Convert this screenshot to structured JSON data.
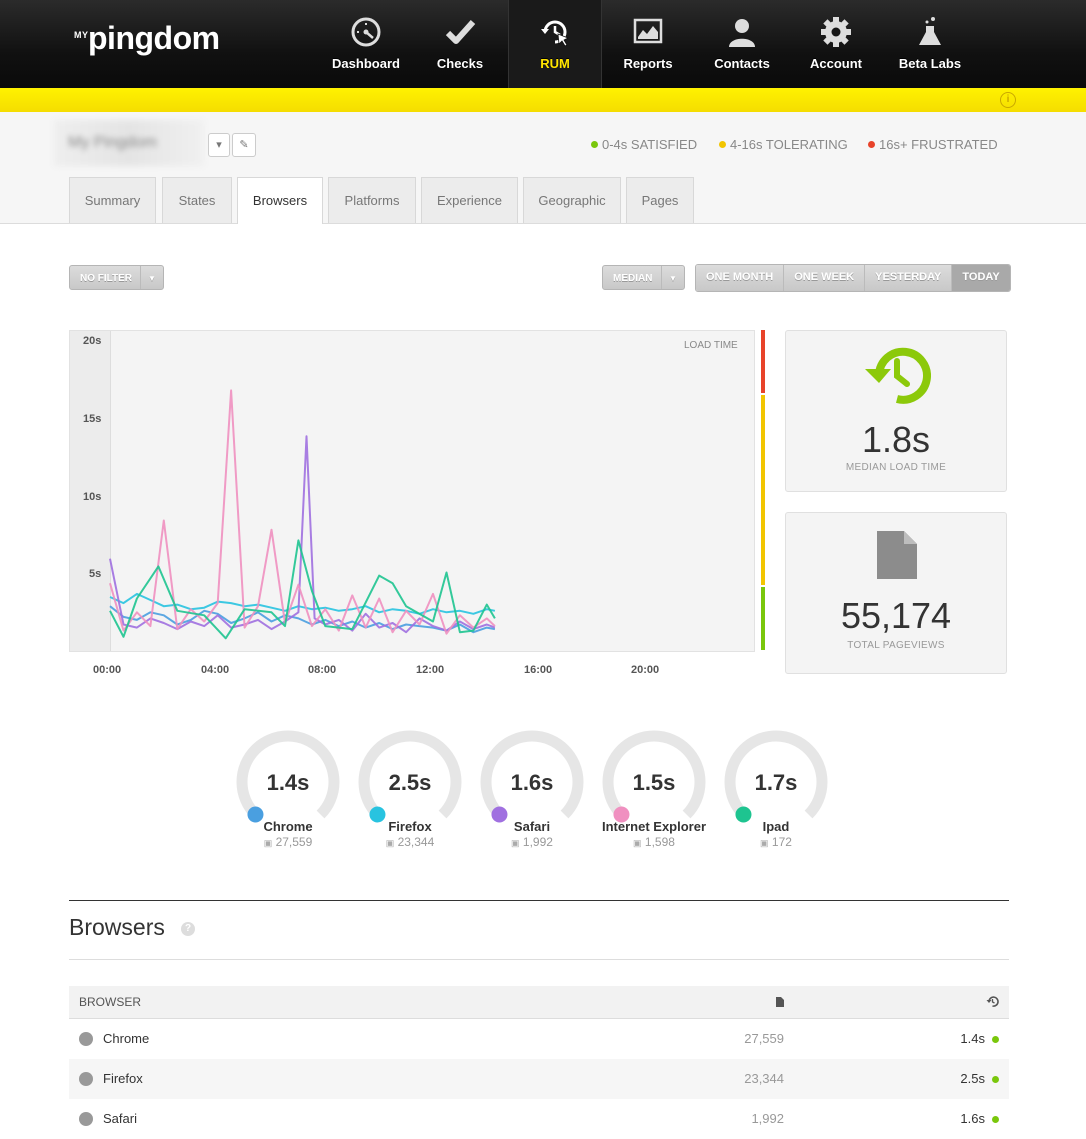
{
  "app": {
    "logo_prefix": "MY",
    "logo_name": "pingdom"
  },
  "nav": [
    {
      "label": "Dashboard",
      "icon": "speedometer-icon"
    },
    {
      "label": "Checks",
      "icon": "checkmark-icon"
    },
    {
      "label": "RUM",
      "icon": "rum-icon",
      "active": true
    },
    {
      "label": "Reports",
      "icon": "reports-icon"
    },
    {
      "label": "Contacts",
      "icon": "person-icon"
    },
    {
      "label": "Account",
      "icon": "gear-icon"
    },
    {
      "label": "Beta Labs",
      "icon": "flask-icon"
    }
  ],
  "site": {
    "name": "My Pingdom"
  },
  "legend": [
    {
      "label": "0-4s SATISFIED",
      "color": "#7ac70c"
    },
    {
      "label": "4-16s TOLERATING",
      "color": "#f2c500"
    },
    {
      "label": "16s+ FRUSTRATED",
      "color": "#e8432a"
    }
  ],
  "tabs": [
    "Summary",
    "States",
    "Browsers",
    "Platforms",
    "Experience",
    "Geographic",
    "Pages"
  ],
  "active_tab": "Browsers",
  "filters": {
    "filter": "NO FILTER",
    "aggregate": "MEDIAN",
    "ranges": [
      "ONE MONTH",
      "ONE WEEK",
      "YESTERDAY",
      "TODAY"
    ],
    "active_range": "TODAY"
  },
  "chart_data": {
    "type": "line",
    "title": "LOAD TIME",
    "y_ticks": [
      "20s",
      "15s",
      "10s",
      "5s"
    ],
    "ylim": [
      0,
      20
    ],
    "x_ticks": [
      "00:00",
      "04:00",
      "08:00",
      "12:00",
      "16:00",
      "20:00"
    ],
    "xlim": [
      0,
      24
    ],
    "grid": false,
    "series": [
      {
        "name": "Chrome",
        "color": "#4a9fe0",
        "x": [
          0,
          0.5,
          1,
          1.5,
          2,
          2.5,
          3,
          3.5,
          4,
          4.5,
          5,
          5.5,
          6,
          6.5,
          7,
          7.5,
          8,
          8.5,
          9,
          9.5,
          10,
          10.5,
          11,
          11.5,
          12,
          12.5,
          13,
          13.5,
          14,
          14.3
        ],
        "y": [
          2.8,
          2.1,
          1.9,
          2.4,
          2.2,
          1.6,
          1.9,
          2.5,
          2.3,
          1.7,
          2.0,
          2.4,
          1.8,
          2.2,
          2.0,
          1.6,
          1.9,
          1.5,
          1.8,
          1.4,
          1.7,
          1.3,
          1.6,
          1.5,
          1.4,
          1.2,
          1.6,
          1.1,
          1.4,
          1.3
        ]
      },
      {
        "name": "Firefox",
        "color": "#28c3e0",
        "x": [
          0,
          0.5,
          1,
          1.5,
          2,
          2.5,
          3,
          3.5,
          4,
          4.5,
          5,
          5.5,
          6,
          6.5,
          7,
          7.5,
          8,
          8.5,
          9,
          9.5,
          10,
          10.5,
          11,
          11.5,
          12,
          12.5,
          13,
          13.5,
          14,
          14.3
        ],
        "y": [
          3.4,
          3.0,
          3.6,
          3.2,
          2.8,
          2.9,
          2.6,
          2.7,
          3.1,
          3.0,
          2.8,
          2.9,
          2.7,
          2.5,
          2.8,
          2.6,
          2.7,
          2.5,
          2.6,
          2.8,
          2.4,
          2.6,
          2.5,
          2.3,
          2.6,
          2.4,
          2.5,
          2.3,
          2.6,
          2.5
        ]
      },
      {
        "name": "Safari",
        "color": "#a070e0",
        "x": [
          0,
          0.5,
          1,
          1.5,
          2,
          2.5,
          3,
          3.5,
          4,
          4.5,
          5,
          5.5,
          6,
          6.5,
          7,
          7.3,
          7.6,
          8,
          8.5,
          9,
          9.5,
          10,
          10.5,
          11,
          11.5,
          12,
          12.5,
          13,
          13.5,
          14,
          14.3
        ],
        "y": [
          5.9,
          1.6,
          1.4,
          2.0,
          1.7,
          1.3,
          1.8,
          1.5,
          2.2,
          1.4,
          1.6,
          1.9,
          1.3,
          1.8,
          2.4,
          13.9,
          2.0,
          1.6,
          1.9,
          1.2,
          2.3,
          1.4,
          1.7,
          1.1,
          2.0,
          1.5,
          1.2,
          1.8,
          1.3,
          1.6,
          1.4
        ]
      },
      {
        "name": "Internet Explorer",
        "color": "#f090c0",
        "x": [
          0,
          0.5,
          1,
          1.5,
          2,
          2.5,
          3,
          3.5,
          4,
          4.5,
          5,
          5.5,
          6,
          6.5,
          7,
          7.5,
          8,
          8.5,
          9,
          9.5,
          10,
          10.5,
          11,
          11.5,
          12,
          12.5,
          13,
          13.5,
          14,
          14.3
        ],
        "y": [
          4.3,
          1.2,
          2.4,
          1.5,
          8.4,
          1.3,
          2.6,
          1.8,
          3.0,
          16.9,
          1.4,
          2.8,
          7.8,
          1.7,
          4.2,
          1.5,
          2.6,
          1.2,
          3.5,
          1.4,
          3.3,
          1.1,
          2.5,
          1.6,
          3.6,
          1.0,
          2.2,
          1.4,
          2.0,
          1.5
        ]
      },
      {
        "name": "Ipad",
        "color": "#1ec490",
        "x": [
          0,
          0.5,
          1,
          1.8,
          2.5,
          3.5,
          4.3,
          5,
          6,
          6.5,
          7,
          7.5,
          8,
          9,
          10,
          10.5,
          11,
          12,
          12.5,
          13,
          13.5,
          14,
          14.3
        ],
        "y": [
          2.5,
          0.8,
          3.3,
          5.4,
          2.5,
          2.2,
          0.7,
          2.6,
          2.4,
          1.5,
          7.1,
          3.8,
          1.5,
          1.3,
          4.8,
          4.3,
          2.8,
          1.8,
          5.0,
          1.1,
          1.2,
          2.9,
          2.0
        ]
      }
    ]
  },
  "stats": {
    "median_value": "1.8s",
    "median_label": "MEDIAN LOAD TIME",
    "pageviews_value": "55,174",
    "pageviews_label": "TOTAL PAGEVIEWS"
  },
  "gauges": [
    {
      "value": "1.4s",
      "name": "Chrome",
      "count": "27,559",
      "color": "#4a9fe0"
    },
    {
      "value": "2.5s",
      "name": "Firefox",
      "count": "23,344",
      "color": "#28c3e0"
    },
    {
      "value": "1.6s",
      "name": "Safari",
      "count": "1,992",
      "color": "#a070e0"
    },
    {
      "value": "1.5s",
      "name": "Internet Explorer",
      "count": "1,598",
      "color": "#f090c0"
    },
    {
      "value": "1.7s",
      "name": "Ipad",
      "count": "172",
      "color": "#1ec490"
    }
  ],
  "browsers_section": {
    "title": "Browsers",
    "help": "?",
    "column_browser": "BROWSER",
    "rows": [
      {
        "name": "Chrome",
        "views": "27,559",
        "time": "1.4s",
        "icon": "chrome-icon"
      },
      {
        "name": "Firefox",
        "views": "23,344",
        "time": "2.5s",
        "icon": "firefox-icon"
      },
      {
        "name": "Safari",
        "views": "1,992",
        "time": "1.6s",
        "icon": "safari-icon"
      }
    ]
  }
}
